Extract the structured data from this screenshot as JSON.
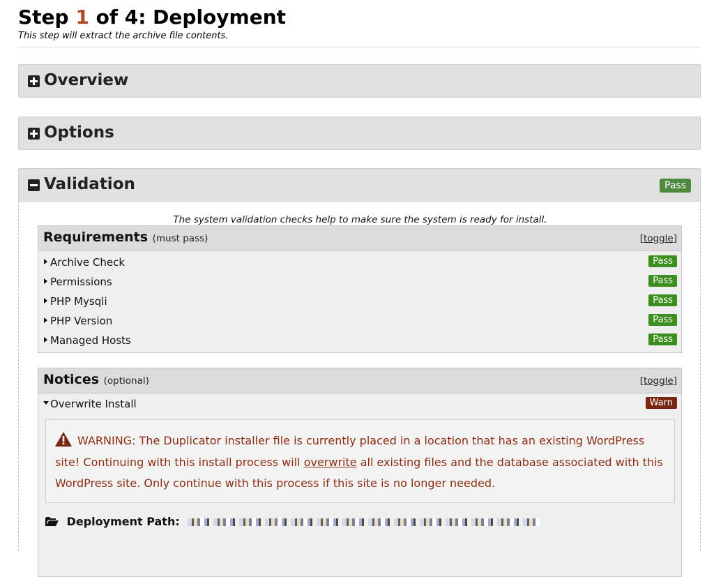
{
  "header": {
    "step_prefix": "Step",
    "step_number": "1",
    "step_suffix": "of 4: Deployment",
    "subtitle": "This step will extract the archive file contents."
  },
  "sections": {
    "overview": {
      "label": "Overview",
      "icon": "plus-square-icon"
    },
    "options": {
      "label": "Options",
      "icon": "plus-square-icon"
    },
    "validation": {
      "label": "Validation",
      "icon": "minus-square-icon",
      "status": "Pass"
    }
  },
  "validation": {
    "intro": "The system validation checks help to make sure the system is ready for install.",
    "requirements": {
      "title": "Requirements",
      "qualifier": "(must pass)",
      "toggle": "[toggle]",
      "items": [
        {
          "label": "Archive Check",
          "status": "Pass"
        },
        {
          "label": "Permissions",
          "status": "Pass"
        },
        {
          "label": "PHP Mysqli",
          "status": "Pass"
        },
        {
          "label": "PHP Version",
          "status": "Pass"
        },
        {
          "label": "Managed Hosts",
          "status": "Pass"
        }
      ]
    },
    "notices": {
      "title": "Notices",
      "qualifier": "(optional)",
      "toggle": "[toggle]",
      "items": [
        {
          "label": "Overwrite Install",
          "status": "Warn"
        }
      ],
      "warning": {
        "part1": "WARNING: The Duplicator installer file is currently placed in a location that has an existing WordPress site! Continuing with this install process will",
        "link": "overwrite",
        "part2": "all existing files and the database associated with this WordPress site. Only continue with this process if this site is no longer needed."
      },
      "deployment_path_label": "Deployment Path:"
    }
  },
  "colors": {
    "step_number": "#b0482b",
    "pass_green": "#3c8f1f",
    "pass_section": "#4d8a3f",
    "warn_red": "#7a2613",
    "warning_text": "#8a2c10"
  }
}
